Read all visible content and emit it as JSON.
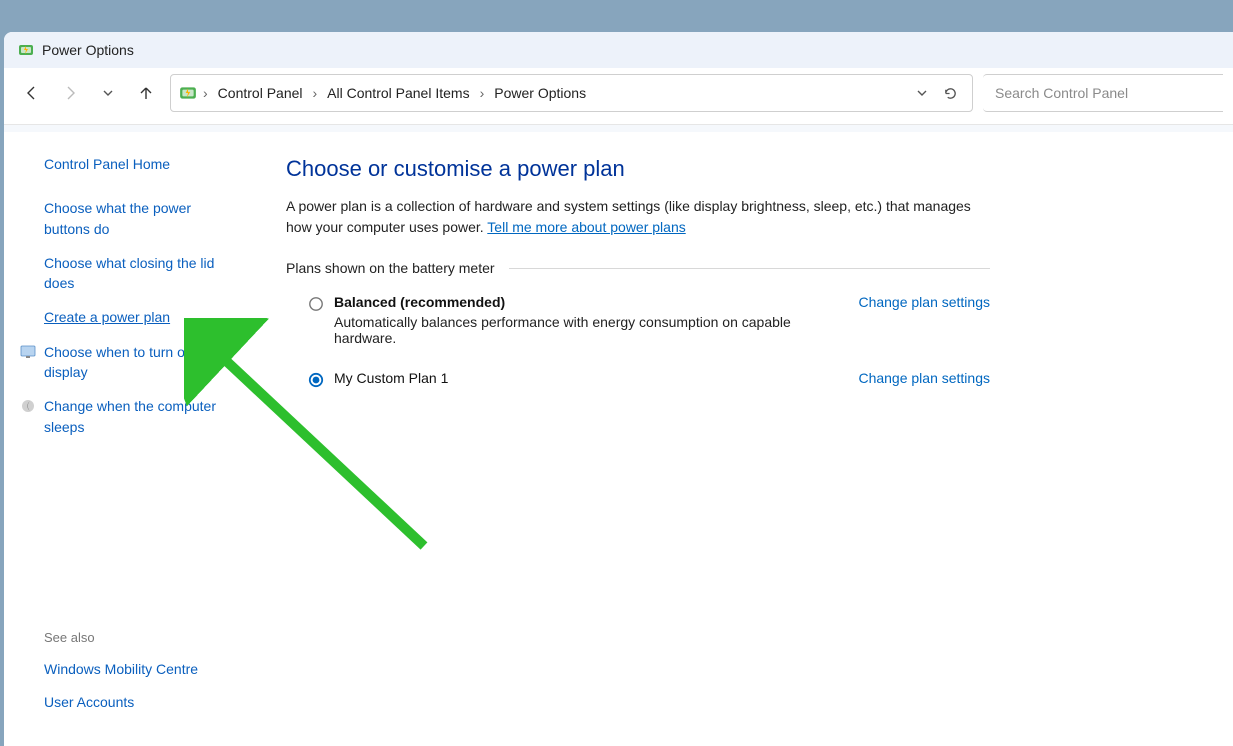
{
  "window": {
    "title": "Power Options"
  },
  "breadcrumb": {
    "items": [
      "Control Panel",
      "All Control Panel Items",
      "Power Options"
    ]
  },
  "search": {
    "placeholder": "Search Control Panel"
  },
  "sidebar": {
    "home": "Control Panel Home",
    "links": [
      {
        "label": "Choose what the power buttons do"
      },
      {
        "label": "Choose what closing the lid does"
      },
      {
        "label": "Create a power plan",
        "active": true
      },
      {
        "label": "Choose when to turn off the display",
        "icon": "display"
      },
      {
        "label": "Change when the computer sleeps",
        "icon": "moon"
      }
    ],
    "see_also_label": "See also",
    "see_also": [
      "Windows Mobility Centre",
      "User Accounts"
    ]
  },
  "main": {
    "heading": "Choose or customise a power plan",
    "description_pre": "A power plan is a collection of hardware and system settings (like display brightness, sleep, etc.) that manages how your computer uses power. ",
    "description_link": "Tell me more about power plans",
    "section_label": "Plans shown on the battery meter",
    "plans": [
      {
        "name": "Balanced (recommended)",
        "subtitle": "Automatically balances performance with energy consumption on capable hardware.",
        "selected": false,
        "change_label": "Change plan settings"
      },
      {
        "name": "My Custom Plan 1",
        "subtitle": "",
        "selected": true,
        "change_label": "Change plan settings"
      }
    ]
  }
}
